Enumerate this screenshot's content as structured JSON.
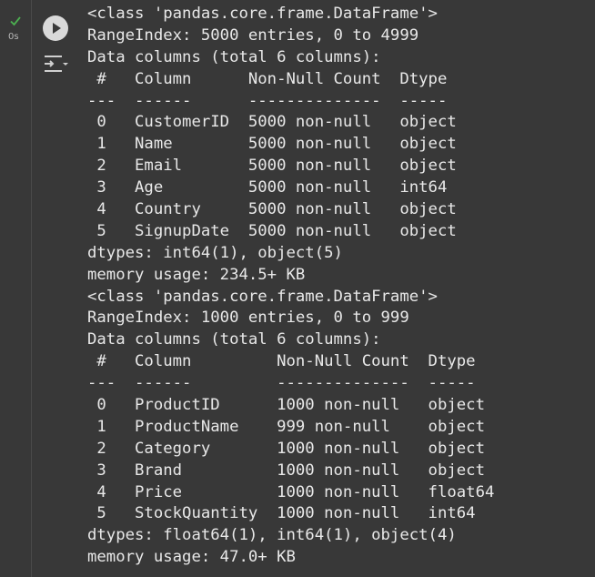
{
  "gutter": {
    "status_icon": "check-icon",
    "exec_time": "0s",
    "status_color": "#4caf50"
  },
  "controls": {
    "run_icon": "play-icon",
    "output_icon": "output-toggle-icon"
  },
  "output_lines": [
    "<class 'pandas.core.frame.DataFrame'>",
    "RangeIndex: 5000 entries, 0 to 4999",
    "Data columns (total 6 columns):",
    " #   Column      Non-Null Count  Dtype ",
    "---  ------      --------------  ----- ",
    " 0   CustomerID  5000 non-null   object",
    " 1   Name        5000 non-null   object",
    " 2   Email       5000 non-null   object",
    " 3   Age         5000 non-null   int64 ",
    " 4   Country     5000 non-null   object",
    " 5   SignupDate  5000 non-null   object",
    "dtypes: int64(1), object(5)",
    "memory usage: 234.5+ KB",
    "<class 'pandas.core.frame.DataFrame'>",
    "RangeIndex: 1000 entries, 0 to 999",
    "Data columns (total 6 columns):",
    " #   Column         Non-Null Count  Dtype  ",
    "---  ------         --------------  -----  ",
    " 0   ProductID      1000 non-null   object ",
    " 1   ProductName    999 non-null    object ",
    " 2   Category       1000 non-null   object ",
    " 3   Brand          1000 non-null   object ",
    " 4   Price          1000 non-null   float64",
    " 5   StockQuantity  1000 non-null   int64  ",
    "dtypes: float64(1), int64(1), object(4)",
    "memory usage: 47.0+ KB"
  ]
}
